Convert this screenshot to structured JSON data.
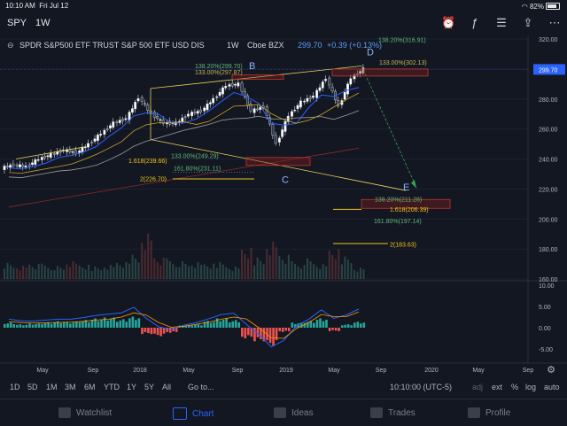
{
  "status_bar": {
    "time": "10:10 AM",
    "date": "Fri Jul 12",
    "battery": "82%"
  },
  "header": {
    "symbol": "SPY",
    "interval": "1W"
  },
  "legend": {
    "title": "SPDR S&P500 ETF TRUST S&P 500 ETF USD DIS",
    "interval": "1W",
    "exchange": "Cboe BZX",
    "last": "299.70",
    "change": "+0.39 (+0.13%)"
  },
  "price_axis": {
    "ticks": [
      "320.00",
      "300.00",
      "280.00",
      "260.00",
      "240.00",
      "220.00",
      "200.00",
      "180.00",
      "160.00"
    ],
    "last_price_label": "299.70",
    "colors": {
      "last_price": "#2962ff"
    }
  },
  "osc_axis": {
    "ticks": [
      "10.00",
      "5.00",
      "0.00",
      "-5.00"
    ]
  },
  "time_axis": {
    "ticks": [
      "May",
      "Sep",
      "2018",
      "May",
      "Sep",
      "2019",
      "May",
      "Sep",
      "2020",
      "May",
      "Sep"
    ]
  },
  "annotations": {
    "wave_labels": [
      "B",
      "C",
      "D",
      "E"
    ],
    "fib_labels": [
      "138.20%(316.91)",
      "138.20%(299.70)",
      "133.00%(302.13)",
      "133.00%(297.87)",
      "133.00%(249.29)",
      "1.618(239.66)",
      "161.80%(231.11)",
      "2(226.70)",
      "138.20%(211.28)",
      "1.618(206.39)",
      "161.80%(197.14)",
      "2(183.63)"
    ]
  },
  "chart_data": {
    "type": "candlestick",
    "title": "SPDR S&P500 ETF TRUST S&P 500 ETF USD DIS",
    "interval": "1W",
    "ylim": [
      160,
      320
    ],
    "x": [
      "2017-03",
      "2017-04",
      "2017-05",
      "2017-06",
      "2017-07",
      "2017-08",
      "2017-09",
      "2017-10",
      "2017-11",
      "2017-12",
      "2018-01",
      "2018-02",
      "2018-03",
      "2018-04",
      "2018-05",
      "2018-06",
      "2018-07",
      "2018-08",
      "2018-09",
      "2018-10",
      "2018-11",
      "2018-12",
      "2019-01",
      "2019-02",
      "2019-03",
      "2019-04",
      "2019-05",
      "2019-06",
      "2019-07"
    ],
    "close": [
      236,
      235,
      240,
      243,
      246,
      244,
      250,
      257,
      264,
      267,
      281,
      270,
      264,
      264,
      270,
      272,
      280,
      289,
      290,
      272,
      275,
      250,
      269,
      278,
      282,
      294,
      275,
      294,
      300
    ],
    "last": 299.7,
    "volume_ylim": [
      0,
      100
    ],
    "volume": [
      30,
      25,
      28,
      26,
      22,
      30,
      24,
      22,
      25,
      30,
      45,
      85,
      40,
      35,
      30,
      28,
      26,
      30,
      22,
      55,
      40,
      70,
      45,
      30,
      35,
      25,
      50,
      40,
      20
    ],
    "oscillator": {
      "ylim": [
        -7.5,
        10
      ],
      "histogram": [
        1.2,
        0.8,
        1.0,
        1.3,
        1.5,
        1.4,
        1.8,
        2.2,
        2.4,
        2.0,
        2.6,
        -1.5,
        -2.0,
        -1.2,
        0.5,
        0.8,
        1.6,
        2.2,
        1.8,
        -2.5,
        -3.2,
        -4.2,
        -1.0,
        1.2,
        1.6,
        2.2,
        -0.8,
        0.8,
        1.4
      ],
      "signal_line": [
        2.0,
        1.6,
        1.6,
        1.8,
        2.0,
        2.0,
        2.4,
        2.9,
        3.2,
        3.5,
        4.8,
        2.2,
        0.2,
        -0.5,
        0.6,
        1.2,
        2.1,
        3.1,
        3.4,
        0.8,
        -1.6,
        -4.5,
        -3.0,
        0.4,
        2.0,
        4.2,
        2.2,
        3.0,
        4.4
      ]
    }
  }
}
